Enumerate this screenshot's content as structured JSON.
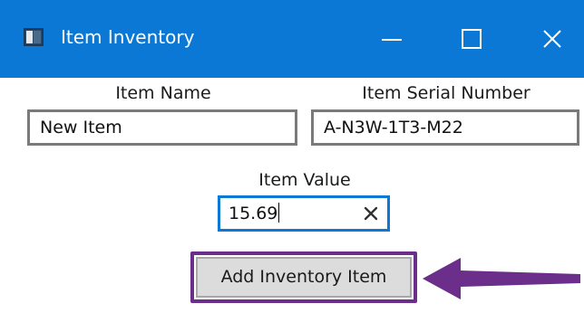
{
  "window": {
    "title": "Item Inventory",
    "title_bar_color": "#0a78d4",
    "icon": "app-window-icon",
    "controls": [
      "minimize-icon",
      "maximize-icon",
      "close-icon"
    ]
  },
  "form": {
    "item_name": {
      "label": "Item Name",
      "value": "New Item"
    },
    "item_serial_number": {
      "label": "Item Serial Number",
      "value": "A-N3W-1T3-M22"
    },
    "item_value": {
      "label": "Item Value",
      "value": "15.69",
      "focused": true,
      "clear_icon": "clear-x-icon"
    }
  },
  "actions": {
    "add_button_label": "Add Inventory Item"
  },
  "annotation": {
    "highlight_color": "#6b2e8a",
    "arrow_color": "#6b2e8a",
    "arrow_icon": "left-arrow-icon"
  }
}
